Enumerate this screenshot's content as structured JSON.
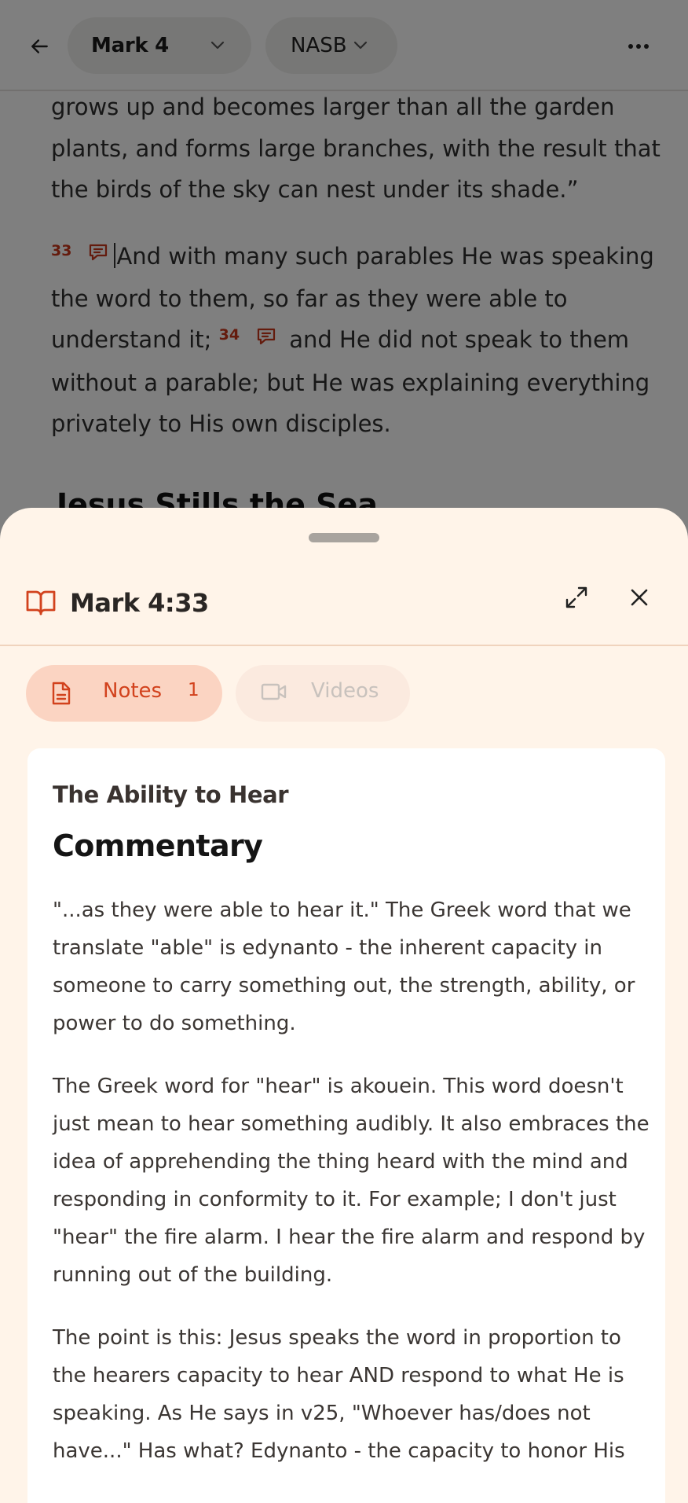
{
  "topbar": {
    "book_label": "Mark 4",
    "version_label": "NASB"
  },
  "scripture": {
    "continuation": "grows up and becomes larger than all the garden plants, and forms large branches, with the result that the birds of the sky can nest under its shade.”",
    "verse33_num": "33",
    "verse33_text": "And with many such parables He was speaking the word to them, so far as they were able to understand it;",
    "verse34_num": "34",
    "verse34_text": "and He did not speak to them without a parable; but He was explaining everything privately to His own disciples.",
    "next_heading": "Jesus Stills the Sea"
  },
  "sheet": {
    "title": "Mark 4:33",
    "tabs": [
      {
        "label": "Notes",
        "count": "1"
      },
      {
        "label": "Videos"
      }
    ],
    "note": {
      "title": "The Ability to Hear",
      "heading": "Commentary",
      "paragraphs": [
        "\"...as they were able to hear it.\" The Greek word that we translate \"able\" is edynanto - the inherent capacity in someone to carry something out, the strength, ability, or power to do something.",
        "The Greek word for \"hear\" is akouein. This word doesn't just mean to hear something audibly. It also embraces the idea of apprehending the thing heard with the mind and responding in conformity to it. For example; I don't just \"hear\" the fire alarm. I hear the fire alarm and respond by running out of the building.",
        "The point is this: Jesus speaks the word in proportion to the hearers capacity to hear AND respond to what He is speaking. As He says in v25, \"Whoever has/does not have...\" Has what? Edynanto - the capacity to honor His"
      ]
    }
  },
  "colors": {
    "accent": "#d2421d",
    "sheet_bg": "#fff4e9",
    "notes_tab_bg": "#fbd4c2",
    "videos_tab_bg": "#fbeadf",
    "verse_number": "#c9361b"
  }
}
